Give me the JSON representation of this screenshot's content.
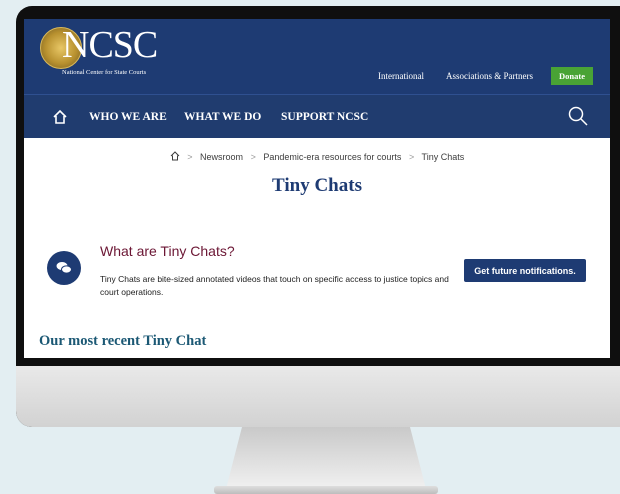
{
  "header": {
    "logo_text": "NCSC",
    "logo_subtitle": "National Center for State Courts",
    "util_links": [
      "International",
      "Associations & Partners"
    ],
    "donate_label": "Donate"
  },
  "nav": {
    "items": [
      "WHO WE ARE",
      "WHAT WE DO",
      "SUPPORT NCSC"
    ]
  },
  "breadcrumb": {
    "items": [
      "Newsroom",
      "Pandemic-era resources for courts",
      "Tiny Chats"
    ],
    "separator": ">"
  },
  "page": {
    "title": "Tiny Chats"
  },
  "intro": {
    "heading": "What are Tiny Chats?",
    "description": "Tiny Chats are bite-sized annotated videos that touch on specific access to justice topics and court operations.",
    "button_label": "Get future notifications."
  },
  "recent": {
    "heading": "Our most recent Tiny Chat"
  },
  "colors": {
    "navy": "#1e3b73",
    "donate_green": "#49a335",
    "heading_maroon": "#6b1634",
    "teal_heading": "#1b5874"
  },
  "icons": [
    "home-icon",
    "search-icon",
    "chat-icon"
  ]
}
